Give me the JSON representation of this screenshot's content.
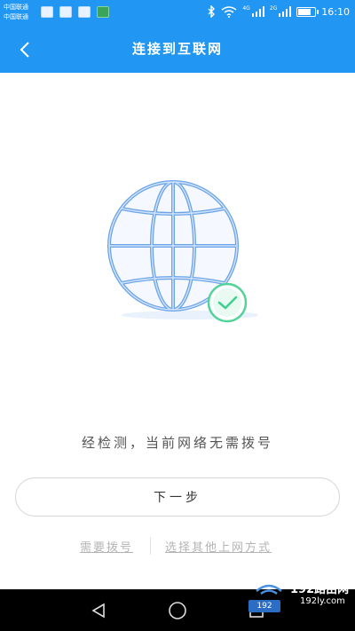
{
  "status_bar": {
    "carrier_1": "中国联通",
    "carrier_2": "中国联通",
    "sig1_label": "4G",
    "sig2_label": "2G",
    "time": "16:10"
  },
  "header": {
    "title": "连接到互联网"
  },
  "main": {
    "result_text": "经检测，当前网络无需拨号",
    "next_button": "下一步",
    "link_dial": "需要拨号",
    "link_other": "选择其他上网方式"
  },
  "watermark": {
    "text_1": "192路由网",
    "text_2": "192ly.com",
    "box_text": "192"
  },
  "colors": {
    "primary": "#2196f3",
    "globe_stroke": "#5b9be4",
    "check_green": "#3ecf8e"
  }
}
